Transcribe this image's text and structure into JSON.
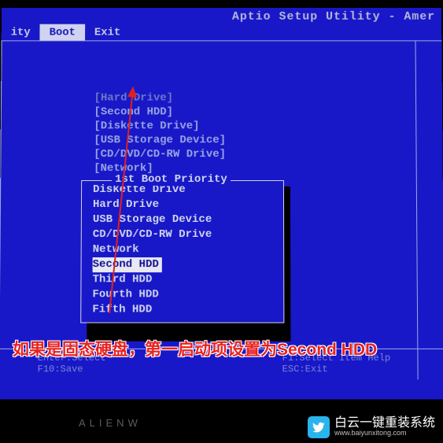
{
  "title": "Aptio Setup Utility - Amer",
  "tabs": {
    "partial": "ity",
    "boot": "Boot",
    "exit": "Exit"
  },
  "boot_category": "[Hard Drive]",
  "boot_items": [
    "[Second HDD]",
    "[Diskette Drive]",
    "[USB Storage Device]",
    "[CD/DVD/CD-RW Drive]",
    "[Network]"
  ],
  "popup": {
    "title": "1st Boot Priority",
    "items": [
      "Diskette Drive",
      "Hard Drive",
      "USB Storage Device",
      "CD/DVD/CD-RW Drive",
      "Network",
      "Second HDD",
      "Third HDD",
      "Fourth HDD",
      "Fifth HDD"
    ],
    "selected_index": 5
  },
  "footer": {
    "left1": "Enter:Select",
    "left2": "F10:Save",
    "right1": "F1:Select Item Help",
    "right2": "ESC:Exit"
  },
  "annotation": "如果是固态硬盘，第一启动项设置为Second HDD",
  "watermark": {
    "text": "白云一键重装系统",
    "url": "www.baiyunxitong.com"
  },
  "laptop_brand": "ALIENW"
}
